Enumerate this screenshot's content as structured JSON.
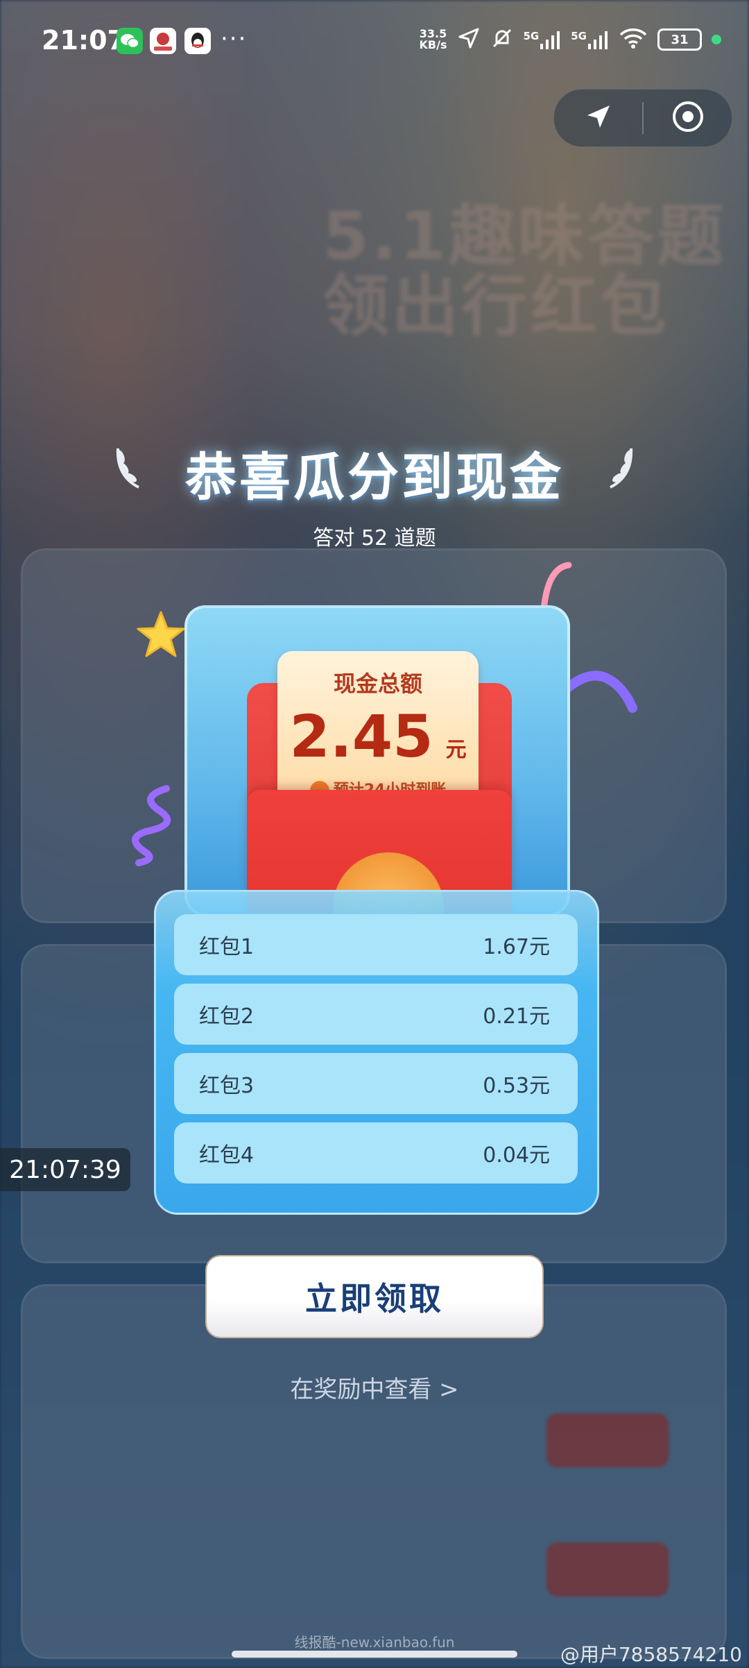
{
  "status_bar": {
    "time": "21:07",
    "more": "···",
    "net_speed_value": "33.5",
    "net_speed_unit": "KB/s",
    "signal_1": "5G",
    "signal_2": "5G",
    "battery": "31",
    "icons": [
      "wechat-icon",
      "app-icon",
      "qq-icon",
      "location-arrow-icon",
      "mute-bell-icon",
      "signal-icon",
      "wifi-icon",
      "battery-icon"
    ]
  },
  "nav_capsule": {
    "icons": [
      "location-arrow-icon",
      "target-icon"
    ]
  },
  "background": {
    "title_line1": "5.1趣味答题",
    "title_line2": "领出行红包"
  },
  "result": {
    "title": "恭喜瓜分到现金",
    "subtitle": "答对 52 道题"
  },
  "red_packet": {
    "label": "现金总额",
    "amount": "2.45",
    "unit": "元",
    "eta": "预计24小时到账"
  },
  "breakdown": [
    {
      "label": "红包1",
      "value": "1.67元"
    },
    {
      "label": "红包2",
      "value": "0.21元"
    },
    {
      "label": "红包3",
      "value": "0.53元"
    },
    {
      "label": "红包4",
      "value": "0.04元"
    }
  ],
  "timestamp": "21:07:39",
  "actions": {
    "claim": "立即领取",
    "view_rewards": "在奖励中查看 >"
  },
  "watermarks": {
    "center": "线报酷-new.xianbao.fun",
    "right": "@用户7858574210"
  },
  "colors": {
    "accent_blue": "#3aa7ec",
    "packet_red": "#e2332e",
    "amount_red": "#b52a12",
    "claim_text": "#1a3f78"
  }
}
